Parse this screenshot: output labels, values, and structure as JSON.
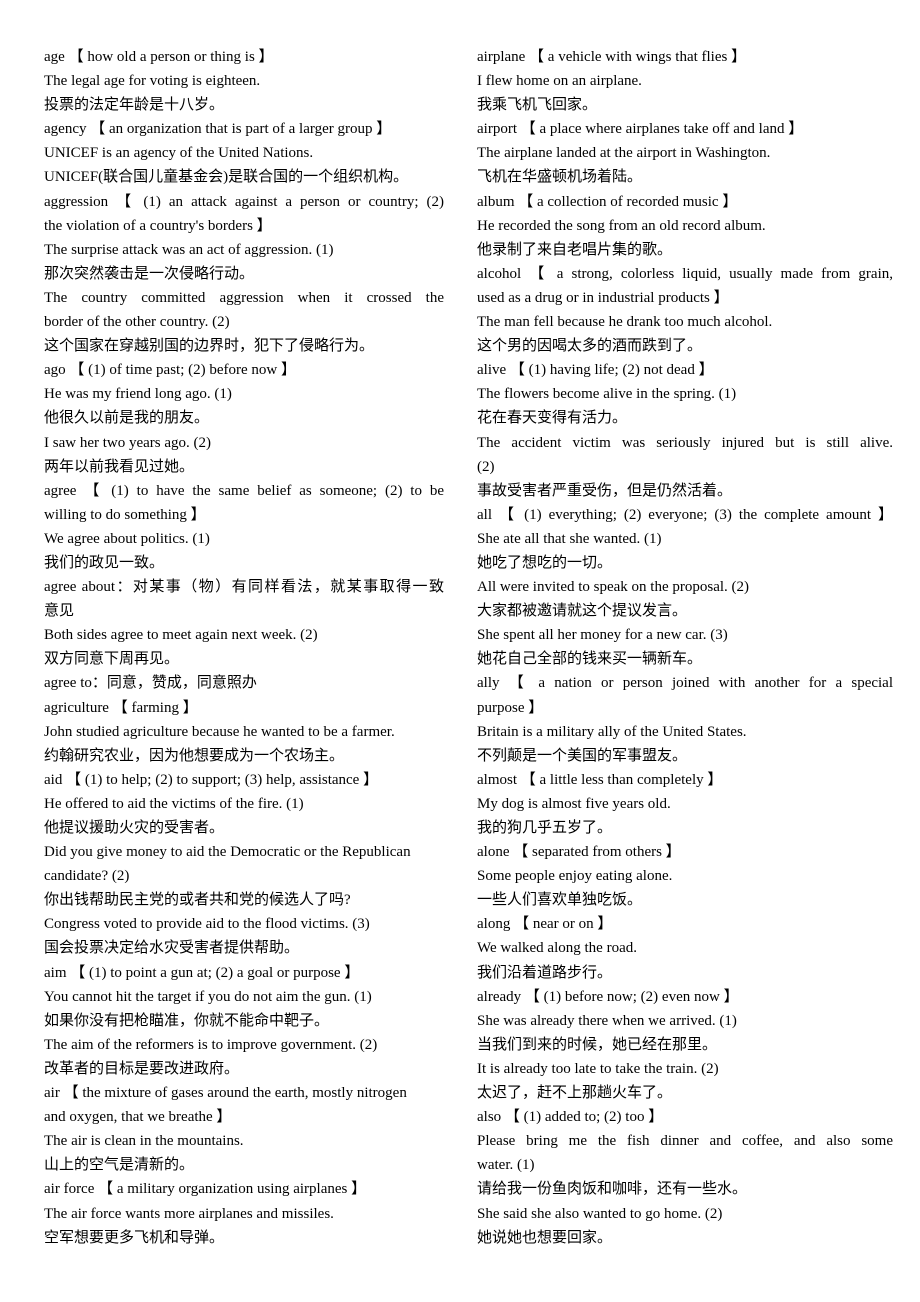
{
  "columns": [
    {
      "lines": [
        "age  【  how old a person or thing is  】",
        "The legal age for voting is eighteen.",
        "投票的法定年龄是十八岁。",
        "agency  【  an organization that is part of a larger group  】",
        "UNICEF is an agency of the United Nations.",
        "UNICEF(联合国儿童基金会)是联合国的一个组织机构。",
        "aggression  【  (1) an attack against a person or country; (2)",
        "the violation of a country's borders  】",
        "The surprise attack was an act of aggression. (1)",
        "那次突然袭击是一次侵略行动。",
        "The country committed aggression when it crossed the",
        "border of the other country. (2)",
        "这个国家在穿越别国的边界时，犯下了侵略行为。",
        "ago  【  (1) of time past; (2) before now  】",
        "He was my friend long ago. (1)",
        "他很久以前是我的朋友。",
        "I saw her two years ago. (2)",
        "两年以前我看见过她。",
        "agree  【  (1) to have the same belief as someone; (2) to be",
        "willing to do something  】",
        "We agree about politics. (1)",
        "我们的政见一致。",
        "agree about：对某事（物）有同样看法，就某事取得一致",
        "意见",
        "Both sides agree to meet again next week. (2)",
        "双方同意下周再见。",
        "agree to：同意，赞成，同意照办",
        "agriculture  【  farming  】",
        "John studied agriculture because he wanted to be a farmer.",
        "约翰研究农业，因为他想要成为一个农场主。",
        "aid  【  (1) to help; (2) to support; (3) help, assistance  】",
        "He offered to aid the victims of the fire. (1)",
        "他提议援助火灾的受害者。",
        "Did you give money to aid the Democratic or the Republican",
        "candidate? (2)",
        "你出钱帮助民主党的或者共和党的候选人了吗?",
        "Congress voted to provide aid to the flood victims. (3)",
        "国会投票决定给水灾受害者提供帮助。",
        "aim  【  (1) to point a gun at; (2) a goal or purpose  】",
        "You cannot hit the target if you do not aim the gun. (1)",
        "如果你没有把枪瞄准，你就不能命中靶子。",
        "The aim of the reformers is to improve government. (2)",
        "改革者的目标是要改进政府。",
        "air  【  the mixture of gases around the earth, mostly nitrogen",
        "and oxygen, that we breathe  】",
        "The air is clean in the mountains.",
        "山上的空气是清新的。",
        "air force  【  a military organization using airplanes  】",
        "The air force wants more airplanes and missiles.",
        "空军想要更多飞机和导弹。"
      ]
    },
    {
      "lines": [
        "airplane  【  a vehicle with wings that flies  】",
        "I flew home on an airplane.",
        "我乘飞机飞回家。",
        "airport  【  a place where airplanes take off and land  】",
        "The airplane landed at the airport in Washington.",
        "飞机在华盛顿机场着陆。",
        "album  【  a collection of recorded music  】",
        "He recorded the song from an old record album.",
        "他录制了来自老唱片集的歌。",
        "alcohol  【  a strong, colorless liquid, usually made from grain,",
        "used as a drug or in industrial products  】",
        "The man fell because he drank too much alcohol.",
        "这个男的因喝太多的酒而跌到了。",
        "alive  【  (1) having life; (2) not dead  】",
        "The flowers become alive in the spring. (1)",
        "花在春天变得有活力。",
        "The accident victim was seriously injured but is still alive.",
        "(2)",
        "事故受害者严重受伤，但是仍然活着。",
        "all  【  (1) everything; (2) everyone; (3) the complete amount  】",
        "She ate all that she wanted. (1)",
        "她吃了想吃的一切。",
        "All were invited to speak on the proposal. (2)",
        "大家都被邀请就这个提议发言。",
        "She spent all her money for a new car. (3)",
        "她花自己全部的钱来买一辆新车。",
        "ally  【  a nation or person joined with another for a special",
        "purpose  】",
        "Britain is a military ally of the United States.",
        "不列颠是一个美国的军事盟友。",
        "almost  【  a little less than completely  】",
        "My dog is almost five years old.",
        "我的狗几乎五岁了。",
        "alone  【  separated from others  】",
        "Some people enjoy eating alone.",
        "一些人们喜欢单独吃饭。",
        "along  【  near or on  】",
        "We walked along the road.",
        "我们沿着道路步行。",
        "already  【  (1) before now; (2) even now  】",
        "She was already there when we arrived. (1)",
        "当我们到来的时候，她已经在那里。",
        "It is already too late to take the train. (2)",
        "太迟了，赶不上那趟火车了。",
        "also  【  (1) added to; (2) too  】",
        "Please bring me the fish dinner and coffee, and also some",
        "water. (1)",
        "请给我一份鱼肉饭和咖啡，还有一些水。",
        "She said she also wanted to go home. (2)",
        "她说她也想要回家。"
      ]
    }
  ]
}
